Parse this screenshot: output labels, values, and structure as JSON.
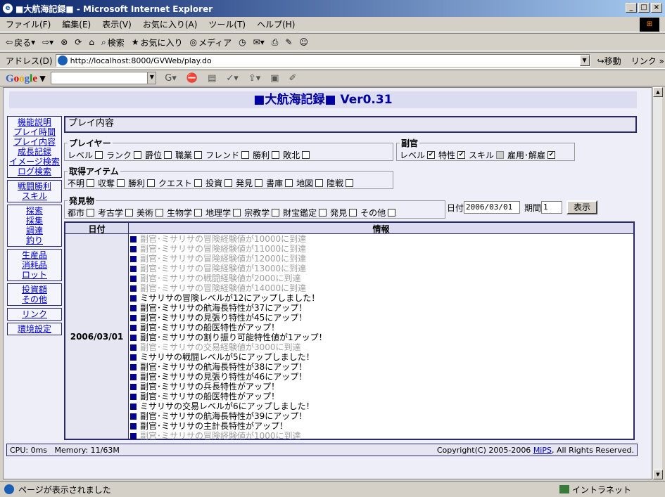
{
  "window": {
    "title": "■大航海記録■ - Microsoft Internet Explorer"
  },
  "menu": [
    "ファイル(F)",
    "編集(E)",
    "表示(V)",
    "お気に入り(A)",
    "ツール(T)",
    "ヘルプ(H)"
  ],
  "toolbar": {
    "back": "戻る",
    "search": "検索",
    "favorites": "お気に入り",
    "media": "メディア"
  },
  "address": {
    "label": "アドレス(D)",
    "url": "http://localhost:8000/GVWeb/play.do",
    "go": "移動",
    "links": "リンク"
  },
  "google": {
    "logo_parts": [
      "G",
      "o",
      "o",
      "g",
      "l",
      "e"
    ]
  },
  "page": {
    "header": "■大航海記録■ Ver0.31",
    "sidebar": [
      [
        "機能説明",
        "プレイ時間",
        "プレイ内容",
        "成長記録",
        "イメージ検索",
        "ログ検索"
      ],
      [
        "戦闘勝利",
        "スキル"
      ],
      [
        "探索",
        "採集",
        "調達",
        "釣り"
      ],
      [
        "生産品",
        "消耗品",
        "ロット"
      ],
      [
        "投資額",
        "その他"
      ],
      [
        "リンク"
      ],
      [
        "環境設定"
      ]
    ],
    "main_title": "プレイ内容",
    "player": {
      "legend": "プレイヤー",
      "items": [
        {
          "label": "レベル",
          "checked": false
        },
        {
          "label": "ランク",
          "checked": false
        },
        {
          "label": "爵位",
          "checked": false
        },
        {
          "label": "職業",
          "checked": false
        },
        {
          "label": "フレンド",
          "checked": false
        },
        {
          "label": "勝利",
          "checked": false
        },
        {
          "label": "敗北",
          "checked": false
        }
      ]
    },
    "mate": {
      "legend": "副官",
      "items": [
        {
          "label": "レベル",
          "checked": true
        },
        {
          "label": "特性",
          "checked": true
        },
        {
          "label": "スキル",
          "checked": false,
          "disabled": true
        },
        {
          "label": "雇用･解雇",
          "checked": true
        }
      ]
    },
    "items_fs": {
      "legend": "取得アイテム",
      "items": [
        {
          "label": "不明",
          "checked": false
        },
        {
          "label": "収奪",
          "checked": false
        },
        {
          "label": "勝利",
          "checked": false
        },
        {
          "label": "クエスト",
          "checked": false
        },
        {
          "label": "投資",
          "checked": false
        },
        {
          "label": "発見",
          "checked": false
        },
        {
          "label": "書庫",
          "checked": false
        },
        {
          "label": "地図",
          "checked": false
        },
        {
          "label": "陸戦",
          "checked": false
        }
      ]
    },
    "discovery": {
      "legend": "発見物",
      "items": [
        {
          "label": "都市",
          "checked": false
        },
        {
          "label": "考古学",
          "checked": false
        },
        {
          "label": "美術",
          "checked": false
        },
        {
          "label": "生物学",
          "checked": false
        },
        {
          "label": "地理学",
          "checked": false
        },
        {
          "label": "宗教学",
          "checked": false
        },
        {
          "label": "財宝鑑定",
          "checked": false
        },
        {
          "label": "発見",
          "checked": false
        },
        {
          "label": "その他",
          "checked": false
        }
      ]
    },
    "date_form": {
      "date_label": "日付",
      "date_value": "2006/03/01",
      "period_label": "期間",
      "period_value": "1",
      "submit": "表示"
    },
    "table": {
      "col_date": "日付",
      "col_info": "情報",
      "date": "2006/03/01",
      "rows": [
        {
          "text": "副官･ミサリサの冒険経験値が10000に到達",
          "gray": true
        },
        {
          "text": "副官･ミサリサの冒険経験値が11000に到達",
          "gray": true
        },
        {
          "text": "副官･ミサリサの冒険経験値が12000に到達",
          "gray": true
        },
        {
          "text": "副官･ミサリサの冒険経験値が13000に到達",
          "gray": true
        },
        {
          "text": "副官･ミサリサの戦闘経験値が2000に到達",
          "gray": true
        },
        {
          "text": "副官･ミサリサの冒険経験値が14000に到達",
          "gray": true
        },
        {
          "text": "ミサリサの冒険レベルが12にアップしました！",
          "gray": false
        },
        {
          "text": "副官･ミサリサの航海長特性が37にアップ！",
          "gray": false
        },
        {
          "text": "副官･ミサリサの見張り特性が45にアップ！",
          "gray": false
        },
        {
          "text": "副官･ミサリサの船医特性がアップ！",
          "gray": false
        },
        {
          "text": "副官･ミサリサの割り振り可能特性値が1アップ！",
          "gray": false
        },
        {
          "text": "副官･ミサリサの交易経験値が3000に到達",
          "gray": true
        },
        {
          "text": "ミサリサの戦闘レベルが5にアップしました！",
          "gray": false
        },
        {
          "text": "副官･ミサリサの航海長特性が38にアップ！",
          "gray": false
        },
        {
          "text": "副官･ミサリサの見張り特性が46にアップ！",
          "gray": false
        },
        {
          "text": "副官･ミサリサの兵長特性がアップ！",
          "gray": false
        },
        {
          "text": "副官･ミサリサの船医特性がアップ！",
          "gray": false
        },
        {
          "text": "ミサリサの交易レベルが6にアップしました！",
          "gray": false
        },
        {
          "text": "副官･ミサリサの航海長特性が39にアップ！",
          "gray": false
        },
        {
          "text": "副官･ミサリサの主計長特性がアップ！",
          "gray": false
        },
        {
          "text": "副官･ミサリサの冒険経験値が1000に到達",
          "gray": true
        }
      ]
    },
    "footer": {
      "cpu": "CPU: 0ms",
      "memory": "Memory: 11/63M",
      "copyright_pre": "Copyright(C) 2005-2006 ",
      "copyright_link": "MiPS",
      "copyright_post": ", All Rights Reserved."
    }
  },
  "status": {
    "text": "ページが表示されました",
    "zone": "イントラネット"
  }
}
